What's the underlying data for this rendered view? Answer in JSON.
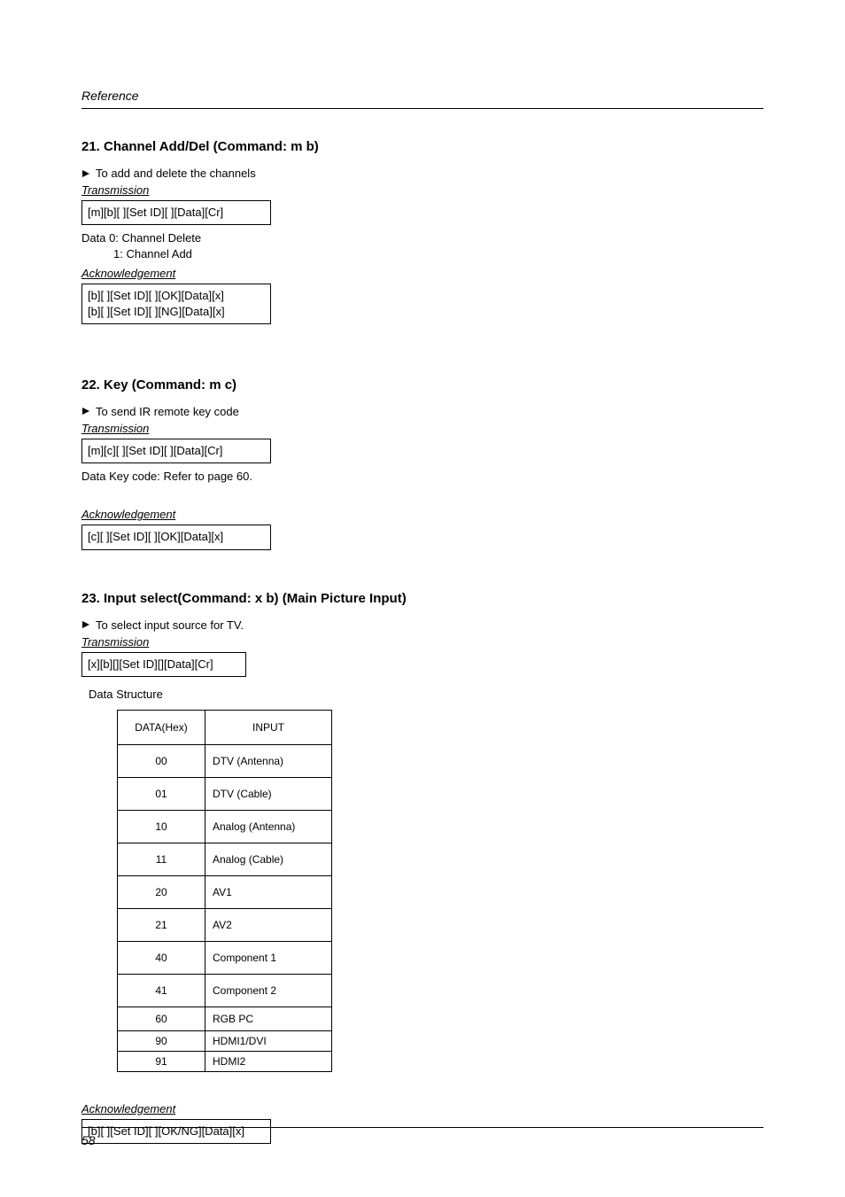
{
  "header": "Reference",
  "sections": {
    "s21": {
      "title": "21. Channel Add/Del (Command: m b)",
      "desc": "To add and delete the channels",
      "trans_label": "Transmission",
      "trans_code": "[m][b][  ][Set ID][  ][Data][Cr]",
      "data_line1": "Data  0: Channel Delete",
      "data_line2": "1: Channel Add",
      "ack_label": "Acknowledgement",
      "ack_line1": "[b][  ][Set ID][  ][OK][Data][x]",
      "ack_line2": "[b][  ][Set ID][  ][NG][Data][x]"
    },
    "s22": {
      "title": "22. Key (Command: m c)",
      "desc": "To send IR remote key code",
      "trans_label": "Transmission",
      "trans_code": "[m][c][  ][Set ID][  ][Data][Cr]",
      "data_line": "Data  Key code: Refer to page 60.",
      "ack_label": "Acknowledgement",
      "ack_code": "[c][  ][Set ID][  ][OK][Data][x]"
    },
    "s23": {
      "title": "23. Input select(Command: x b) (Main Picture Input)",
      "desc": "To select input source for TV.",
      "trans_label": "Transmission",
      "trans_code": "[x][b][][Set ID][][Data][Cr]",
      "ds_label": "Data Structure",
      "table": {
        "head": {
          "c1": "DATA(Hex)",
          "c2": "INPUT"
        },
        "rows": [
          {
            "c1": "00",
            "c2": "DTV (Antenna)",
            "h": "tall"
          },
          {
            "c1": "01",
            "c2": "DTV (Cable)",
            "h": "tall"
          },
          {
            "c1": "10",
            "c2": "Analog (Antenna)",
            "h": "tall"
          },
          {
            "c1": "11",
            "c2": "Analog (Cable)",
            "h": "tall"
          },
          {
            "c1": "20",
            "c2": "AV1",
            "h": "tall"
          },
          {
            "c1": "21",
            "c2": "AV2",
            "h": "tall"
          },
          {
            "c1": "40",
            "c2": "Component 1",
            "h": "tall"
          },
          {
            "c1": "41",
            "c2": "Component 2",
            "h": "tall"
          },
          {
            "c1": "60",
            "c2": "RGB PC",
            "h": "med"
          },
          {
            "c1": "90",
            "c2": "HDMI1/DVI",
            "h": "short"
          },
          {
            "c1": "91",
            "c2": "HDMI2",
            "h": "short"
          }
        ]
      },
      "ack_label": "Acknowledgement",
      "ack_code": "[b][  ][Set ID][  ][OK/NG][Data][x]"
    }
  },
  "page_number": "58"
}
